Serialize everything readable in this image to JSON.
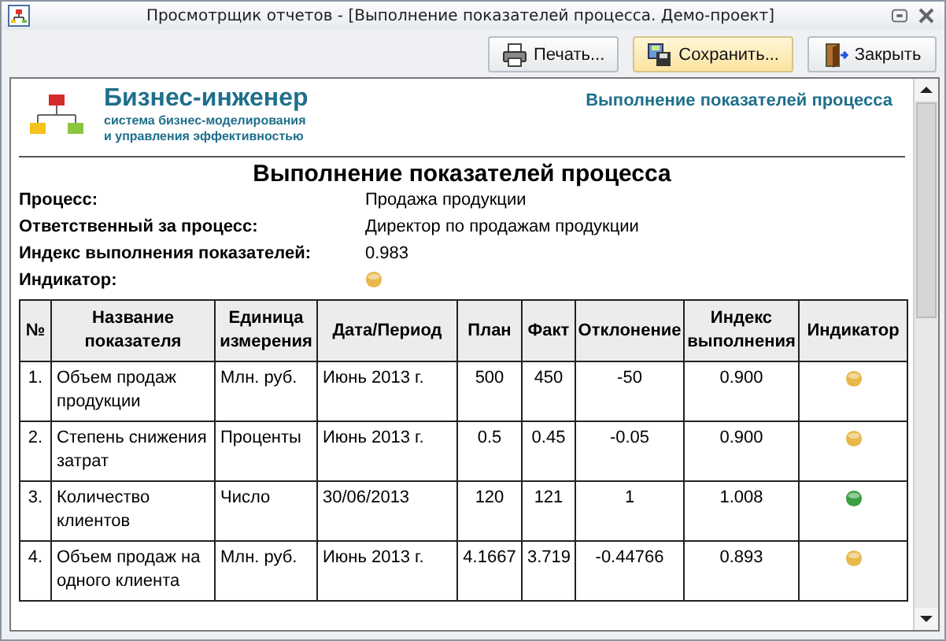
{
  "window": {
    "title": "Просмотрщик отчетов -  [Выполнение показателей процесса. Демо-проект]"
  },
  "toolbar": {
    "buttons": [
      {
        "kind": "print",
        "label": "Печать...",
        "highlighted": false
      },
      {
        "kind": "save",
        "label": "Сохранить...",
        "highlighted": true
      },
      {
        "kind": "close",
        "label": "Закрыть",
        "highlighted": false
      }
    ]
  },
  "report": {
    "brand": {
      "name": "Бизнес-инженер",
      "tagline": [
        "система бизнес-моделирования",
        "и управления эффективностью"
      ]
    },
    "header_title": "Выполнение показателей процесса",
    "title": "Выполнение показателей процесса",
    "fields": [
      {
        "label": "Процесс:",
        "value": "Продажа продукции"
      },
      {
        "label": "Ответственный за процесс:",
        "value": "Директор по продажам продукции"
      },
      {
        "label": "Индекс выполнения показателей:",
        "value": "0.983"
      },
      {
        "label": "Индикатор:",
        "color": "#e8b84a"
      }
    ],
    "table": {
      "columns": [
        "№",
        "Название показателя",
        "Единица измерения",
        "Дата/Период",
        "План",
        "Факт",
        "Отклонение",
        "Индекс выполнения",
        "Индикатор"
      ],
      "rows": [
        {
          "cells": [
            "1.",
            "Объем продаж продукции",
            "Млн. руб.",
            "Июнь 2013 г.",
            "500",
            "450",
            "-50",
            "0.900"
          ],
          "color": "#e8b84a"
        },
        {
          "cells": [
            "2.",
            "Степень снижения затрат",
            "Проценты",
            "Июнь 2013 г.",
            "0.5",
            "0.45",
            "-0.05",
            "0.900"
          ],
          "color": "#e8b84a"
        },
        {
          "cells": [
            "3.",
            "Количество клиентов",
            "Число",
            "30/06/2013",
            "120",
            "121",
            "1",
            "1.008"
          ],
          "color": "#3aa040"
        },
        {
          "cells": [
            "4.",
            "Объем продаж на одного клиента",
            "Млн. руб.",
            "Июнь 2013 г.",
            "4.1667",
            "3.719",
            "-0.44766",
            "0.893"
          ],
          "color": "#e8b84a"
        }
      ]
    }
  }
}
